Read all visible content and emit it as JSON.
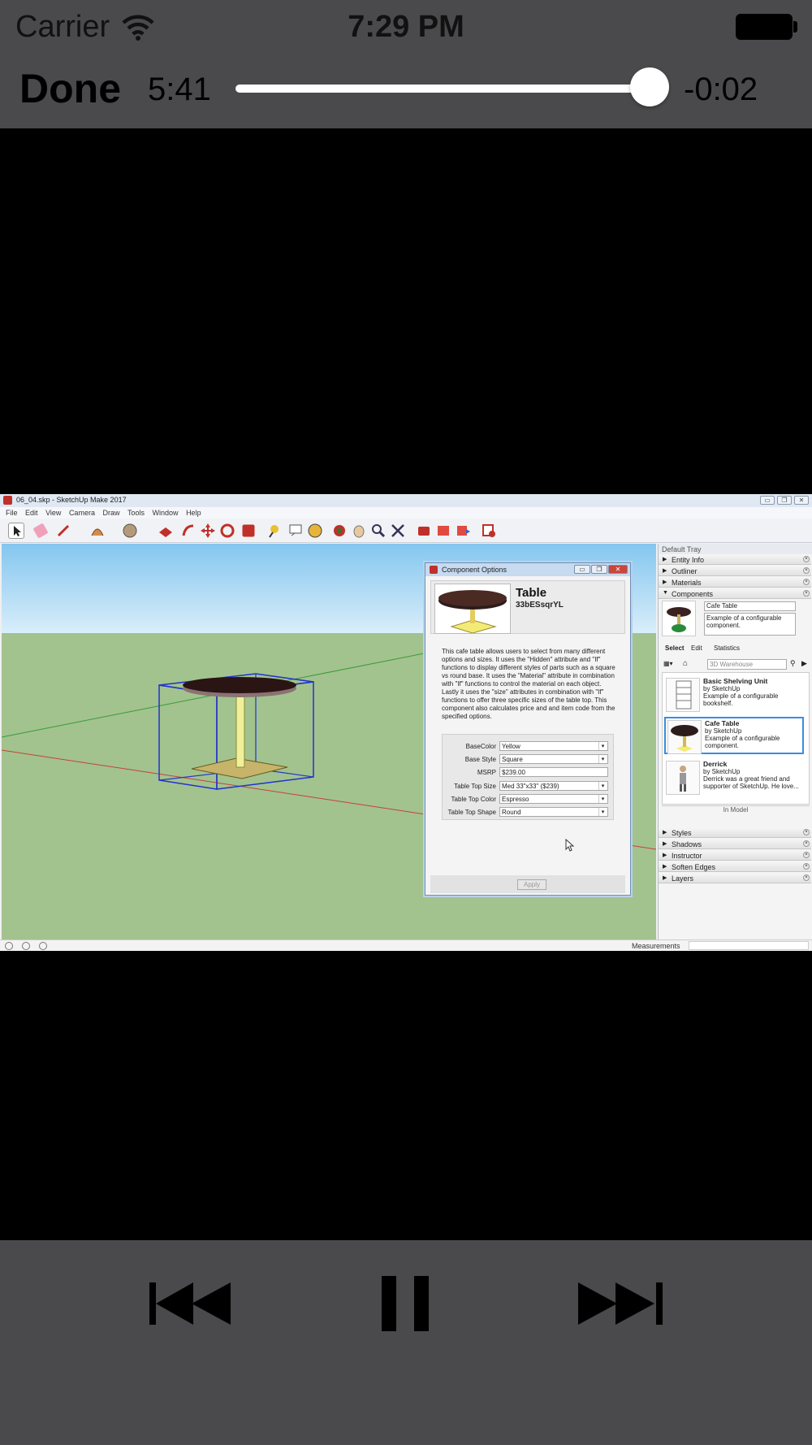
{
  "status_bar": {
    "carrier": "Carrier",
    "time": "7:29 PM",
    "wifi_icon": "wifi-icon",
    "battery_icon": "battery-icon"
  },
  "player": {
    "done_label": "Done",
    "elapsed": "5:41",
    "remaining": "-0:02",
    "progress_fraction": 0.98,
    "controls": {
      "previous_icon": "skip-back-icon",
      "pause_icon": "pause-icon",
      "next_icon": "skip-forward-icon"
    }
  },
  "video": {
    "window_title": "06_04.skp - SketchUp Make 2017",
    "window_buttons": [
      "▭",
      "❐",
      "✕"
    ],
    "menu": [
      "File",
      "Edit",
      "View",
      "Camera",
      "Draw",
      "Tools",
      "Window",
      "Help"
    ],
    "status": {
      "measurements_label": "Measurements"
    },
    "dialog": {
      "title": "Component Options",
      "name": "Table",
      "code": "33bESsqrYL",
      "description": "This cafe table allows users to select from many different options and sizes. It uses the \"Hidden\" attribute and \"If\" functions to display different styles of parts such as a square vs round base. It uses the \"Material\" attribute in combination with \"If\" functions to control the material on each object. Lastly it uses the \"size\" attributes in combination with \"If\" functions to offer three specific sizes of the table top. This component also calculates price and and item code from the specified options.",
      "options": [
        {
          "label": "BaseColor",
          "value": "Yellow",
          "dropdown": true
        },
        {
          "label": "Base Style",
          "value": "Square",
          "dropdown": true
        },
        {
          "label": "MSRP",
          "value": "$239.00",
          "dropdown": false
        },
        {
          "label": "Table Top Size",
          "value": "Med 33\"x33\" ($239)",
          "dropdown": true
        },
        {
          "label": "Table Top Color",
          "value": "Espresso",
          "dropdown": true
        },
        {
          "label": "Table Top Shape",
          "value": "Round",
          "dropdown": true
        }
      ],
      "apply_label": "Apply"
    },
    "tray": {
      "title": "Default Tray",
      "top_sections": [
        "Entity Info",
        "Outliner",
        "Materials",
        "Components"
      ],
      "selected_component": {
        "name": "Cafe Table",
        "description": "Example of a configurable component."
      },
      "tabs": [
        "Select",
        "Edit",
        "Statistics"
      ],
      "search_placeholder": "3D Warehouse",
      "items": [
        {
          "name": "Basic Shelving Unit",
          "by": "by SketchUp",
          "desc": "Example of a configurable bookshelf."
        },
        {
          "name": "Cafe Table",
          "by": "by SketchUp",
          "desc": "Example of a configurable component."
        },
        {
          "name": "Derrick",
          "by": "by SketchUp",
          "desc": "Derrick was a great friend and supporter of SketchUp. He love..."
        }
      ],
      "in_model_label": "In Model",
      "bottom_sections": [
        "Styles",
        "Shadows",
        "Instructor",
        "Soften Edges",
        "Layers"
      ]
    }
  },
  "colors": {
    "bar_bg": "#4a4a4c",
    "video_bg": "#000000",
    "selection_blue": "#3a8de0"
  }
}
